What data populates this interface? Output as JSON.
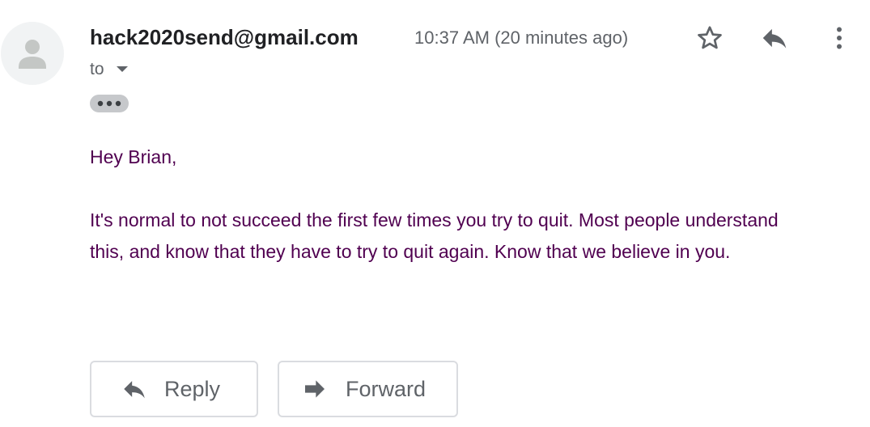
{
  "email": {
    "sender": "hack2020send@gmail.com",
    "timestamp": "10:37 AM (20 minutes ago)",
    "to_label": "to",
    "greeting": "Hey Brian,",
    "message": "It's normal to not succeed the first few times you try to quit. Most people understand this, and know that they have to try to quit again. Know that we believe in you."
  },
  "actions": {
    "reply_label": "Reply",
    "forward_label": "Forward"
  },
  "icons": {
    "avatar": "person-icon",
    "star": "star-icon",
    "reply": "reply-icon",
    "more": "more-vert-icon",
    "dropdown": "arrow-drop-down-icon",
    "ellipsis": "ellipsis-icon",
    "forward": "forward-icon"
  },
  "colors": {
    "body_text": "#500050",
    "sender_text": "#202124",
    "secondary_text": "#5f6368",
    "icon_gray": "#5f6368",
    "button_border": "#dadce0"
  }
}
